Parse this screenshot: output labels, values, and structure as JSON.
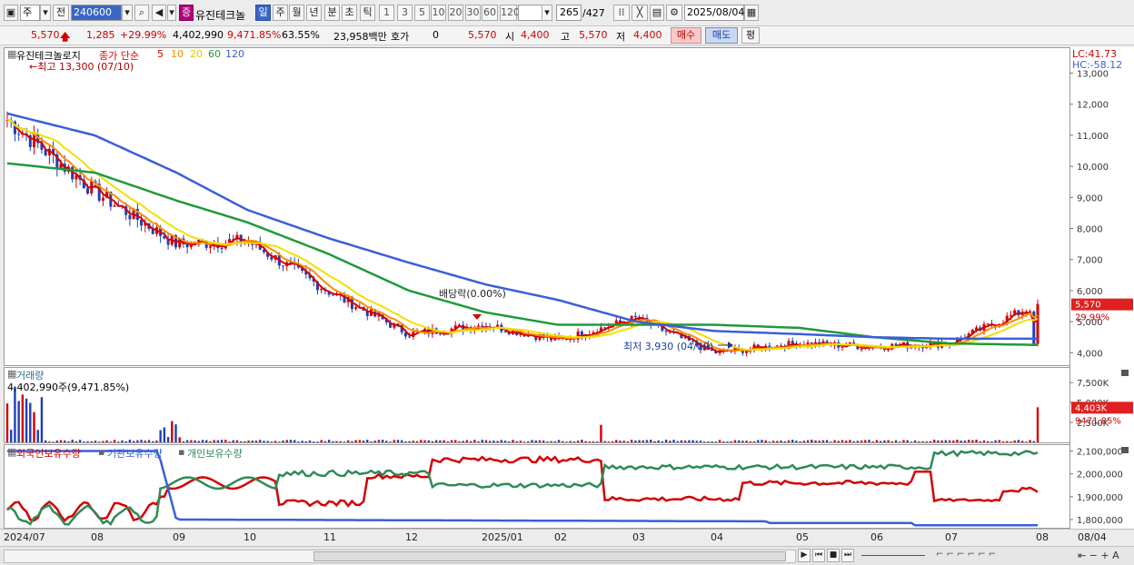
{
  "toolbar": {
    "period_label": "주",
    "prev_label": "전",
    "code": "240600",
    "type_badge": "증",
    "stock_name": "유진테크놀",
    "periods": [
      "일",
      "주",
      "월",
      "년",
      "분",
      "초",
      "틱"
    ],
    "intervals": [
      "1",
      "3",
      "5",
      "10",
      "20",
      "30",
      "60",
      "120"
    ],
    "count": "265",
    "total": "/427",
    "date": "2025/08/04"
  },
  "quote": {
    "price": "5,570",
    "change": "1,285",
    "change_pct": "+29.99%",
    "volume": "4,402,990",
    "volume_pct": "9,471.85%",
    "turnover": "63.55%",
    "amount": "23,958백만",
    "bid_label": "호가",
    "bid_value": "0",
    "hoga_price": "5,570",
    "open_label": "시",
    "open": "4,400",
    "high_label": "고",
    "high": "5,570",
    "low_label": "저",
    "low": "4,400",
    "buy_label": "매수",
    "sell_label": "매도",
    "eval_label": "평"
  },
  "price_panel": {
    "title": "유진테크놀로지",
    "ma_label": "종가 단순",
    "ma_periods": [
      "5",
      "10",
      "20",
      "60",
      "120"
    ],
    "ma_colors": [
      "#d40000",
      "#ff8c00",
      "#f0e000",
      "#1f9a3a",
      "#3a5fd8"
    ],
    "max_note": "←최고 13,300 (07/10)",
    "min_note": "최저 3,930 (04/09)",
    "dividend_note": "배당락(0.00%)",
    "lc": "LC:41.73",
    "hc": "HC:-58.12",
    "current_tag": "5,570",
    "current_pct": "29.99%",
    "y_ticks": [
      "13,000",
      "12,000",
      "11,000",
      "10,000",
      "9,000",
      "8,000",
      "7,000",
      "6,000",
      "5,000",
      "4,000"
    ]
  },
  "volume_panel": {
    "title": "거래량",
    "value_note": "4,402,990주(9,471.85%)",
    "y_ticks": [
      "7,500K",
      "5,000K",
      "2,500K"
    ],
    "current_tag": "4,403K",
    "current_pct": "9471.85%"
  },
  "holding_panel": {
    "legend": [
      "외국인보유수량",
      "기관보유수량",
      "개인보유수량"
    ],
    "colors": [
      "#d40000",
      "#3a5fd8",
      "#2e8b57"
    ],
    "y_ticks": [
      "2,100,000",
      "2,000,000",
      "1,900,000",
      "1,800,000"
    ]
  },
  "x_axis": {
    "labels": [
      "2024/07",
      "08",
      "09",
      "10",
      "11",
      "12",
      "2025/01",
      "02",
      "03",
      "04",
      "05",
      "06",
      "07",
      "08"
    ],
    "right_label": "08/04"
  },
  "chart_data": {
    "type": "candlestick",
    "title": "유진테크놀로지",
    "x": [
      "2024/07",
      "08",
      "09",
      "10",
      "11",
      "12",
      "2025/01",
      "02",
      "03",
      "04",
      "05",
      "06",
      "07",
      "08"
    ],
    "series": [
      {
        "name": "종가",
        "values": [
          11500,
          9200,
          7500,
          7600,
          6000,
          4600,
          4900,
          4400,
          5100,
          4000,
          4300,
          4200,
          4300,
          5570
        ]
      },
      {
        "name": "120",
        "values": [
          11700,
          11000,
          9800,
          8600,
          7700,
          6900,
          6200,
          5700,
          5000,
          4700,
          4600,
          4500,
          4450,
          4450
        ]
      },
      {
        "name": "60",
        "values": [
          10100,
          9800,
          8900,
          8200,
          7200,
          6000,
          5300,
          4900,
          4900,
          4900,
          4800,
          4500,
          4300,
          4250
        ]
      }
    ],
    "annotations": [
      "최고 13,300 (07/10)",
      "최저 3,930 (04/09)",
      "배당락(0.00%)"
    ],
    "ylim": [
      3600,
      13600
    ]
  }
}
